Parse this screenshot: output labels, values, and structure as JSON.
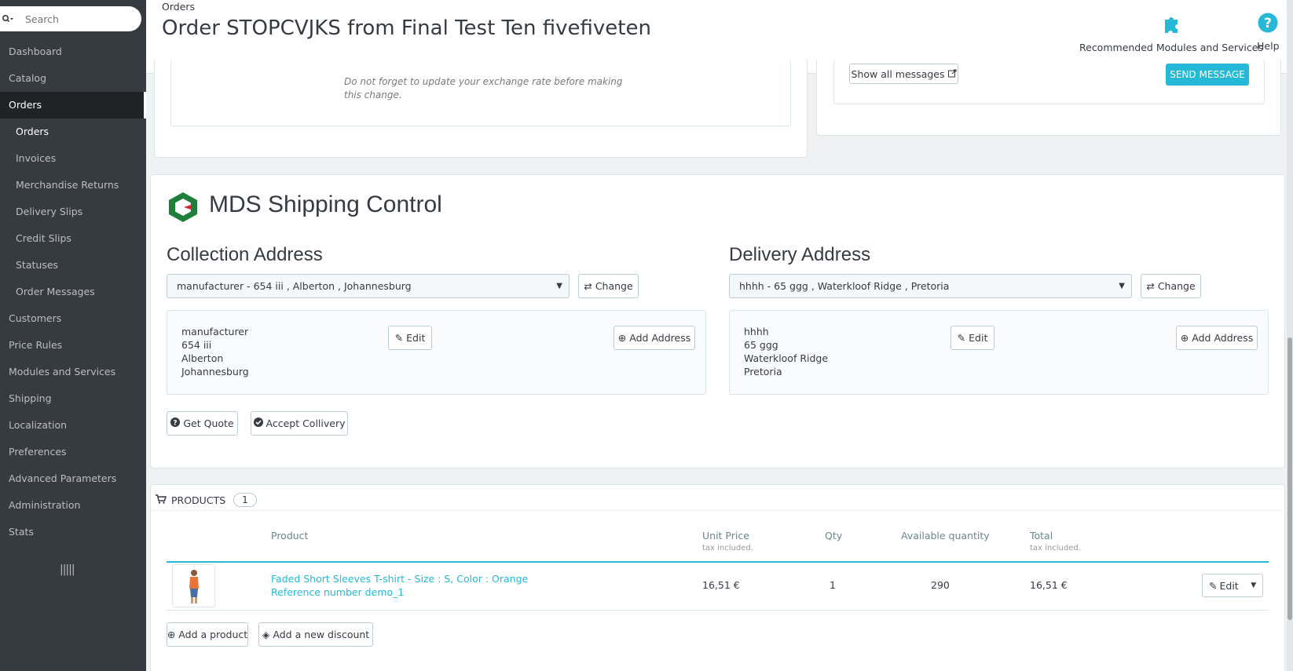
{
  "sidebar": {
    "search_placeholder": "Search",
    "items": [
      {
        "label": "Dashboard"
      },
      {
        "label": "Catalog"
      },
      {
        "label": "Orders"
      },
      {
        "label": "Orders"
      },
      {
        "label": "Invoices"
      },
      {
        "label": "Merchandise Returns"
      },
      {
        "label": "Delivery Slips"
      },
      {
        "label": "Credit Slips"
      },
      {
        "label": "Statuses"
      },
      {
        "label": "Order Messages"
      },
      {
        "label": "Customers"
      },
      {
        "label": "Price Rules"
      },
      {
        "label": "Modules and Services"
      },
      {
        "label": "Shipping"
      },
      {
        "label": "Localization"
      },
      {
        "label": "Preferences"
      },
      {
        "label": "Advanced Parameters"
      },
      {
        "label": "Administration"
      },
      {
        "label": "Stats"
      }
    ]
  },
  "header": {
    "breadcrumb": "Orders",
    "title": "Order STOPCVJKS from Final Test Ten fivefiveten",
    "recommended_label": "Recommended Modules and Services",
    "help_label": "Help"
  },
  "currency_panel": {
    "note": "Do not forget to update your exchange rate before making this change."
  },
  "messages_panel": {
    "show_all_label": "Show all messages",
    "send_label": "SEND MESSAGE"
  },
  "mds": {
    "title": "MDS Shipping Control",
    "collection": {
      "heading": "Collection Address",
      "selected": "manufacturer - 654 iii , Alberton , Johannesburg",
      "change_label": "Change",
      "lines": [
        "manufacturer",
        "654 iii",
        "Alberton",
        "Johannesburg"
      ],
      "edit_label": "Edit",
      "add_label": "Add Address"
    },
    "delivery": {
      "heading": "Delivery Address",
      "selected": "hhhh - 65 ggg , Waterkloof Ridge , Pretoria",
      "change_label": "Change",
      "lines": [
        "hhhh",
        "65 ggg",
        "Waterkloof Ridge",
        "Pretoria"
      ],
      "edit_label": "Edit",
      "add_label": "Add Address"
    },
    "get_quote_label": "Get Quote",
    "accept_label": "Accept Collivery"
  },
  "products": {
    "heading": "PRODUCTS",
    "count": "1",
    "columns": {
      "product": "Product",
      "unit_price": "Unit Price",
      "unit_price_note": "tax included.",
      "qty": "Qty",
      "available": "Available quantity",
      "total": "Total",
      "total_note": "tax included."
    },
    "row": {
      "name": "Faded Short Sleeves T-shirt - Size : S, Color : Orange",
      "reference": "Reference number demo_1",
      "unit_price": "16,51 €",
      "qty": "1",
      "available": "290",
      "total": "16,51 €",
      "edit_label": "Edit"
    },
    "add_product_label": "Add a product",
    "add_discount_label": "Add a new discount"
  },
  "colors": {
    "accent": "#25b9d7",
    "sidebar_bg": "#363a41",
    "brand_green": "#1e7f3a",
    "brand_red": "#d8262f"
  }
}
